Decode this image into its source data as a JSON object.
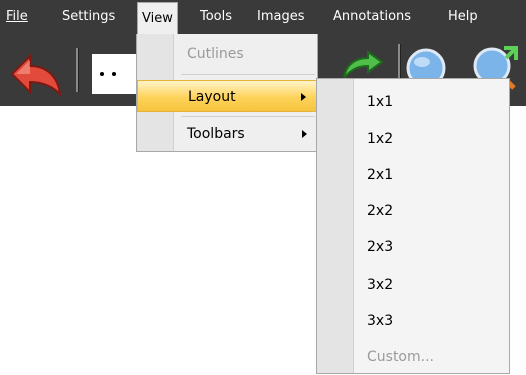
{
  "menubar": {
    "items": [
      {
        "label": "File",
        "mnemonic_first": true
      },
      {
        "label": "Settings"
      },
      {
        "label": "View"
      },
      {
        "label": "Tools"
      },
      {
        "label": "Images"
      },
      {
        "label": "Annotations",
        "mnemonic_first": true
      },
      {
        "label": "Help",
        "mnemonic_first": true
      }
    ]
  },
  "toolbar": {
    "icons": [
      "undo-arrow-icon",
      "dots-icon",
      "redo-arrow-icon",
      "zoom-icon",
      "zoom-fit-icon"
    ]
  },
  "view_menu": {
    "items": [
      {
        "label": "Cutlines",
        "disabled": true
      },
      {
        "label": "Layout",
        "highlighted": true,
        "has_submenu": true
      },
      {
        "label": "Toolbars",
        "has_submenu": true
      }
    ]
  },
  "layout_submenu": {
    "items": [
      {
        "label": "1x1"
      },
      {
        "label": "1x2"
      },
      {
        "label": "2x1"
      },
      {
        "label": "2x2"
      },
      {
        "label": "2x3"
      },
      {
        "label": "3x2"
      },
      {
        "label": "3x3"
      },
      {
        "label": "Custom...",
        "disabled": true
      }
    ]
  },
  "colors": {
    "menubar_bg": "#3a3a3a",
    "menu_bg": "#efefef",
    "highlight": "#ffd35a",
    "disabled_text": "#9a9a9a"
  }
}
